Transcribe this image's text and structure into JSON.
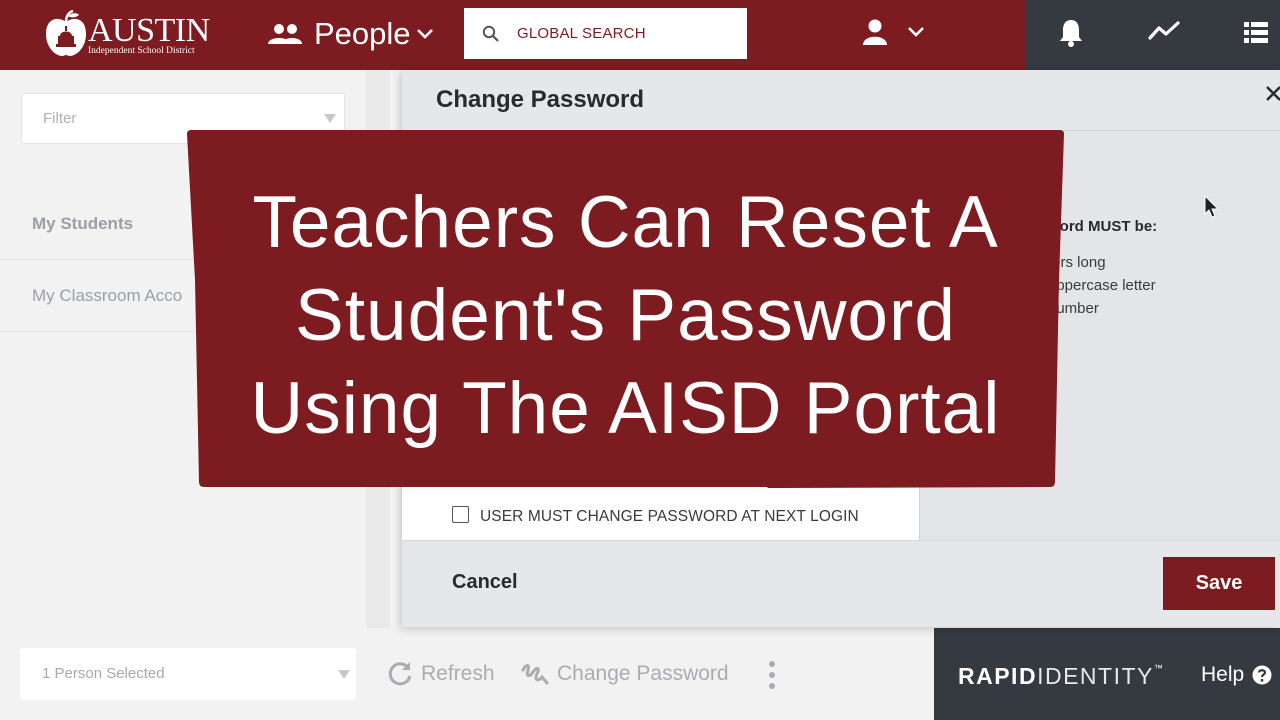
{
  "header": {
    "logo_name": "AUSTIN",
    "logo_subtitle": "Independent School District",
    "module_label": "People",
    "search_placeholder": "GLOBAL SEARCH"
  },
  "sidebar": {
    "filter_placeholder": "Filter",
    "items": [
      {
        "label": "My Students"
      },
      {
        "label": "My Classroom Acco"
      }
    ]
  },
  "bottom_bar": {
    "selection": "1 Person Selected",
    "refresh_label": "Refresh",
    "change_password_label": "Change Password"
  },
  "brand": {
    "name_bold": "RAPID",
    "name_light": "IDENTITY",
    "trademark": "™",
    "help_label": "Help"
  },
  "modal": {
    "title": "Change Password",
    "requirements_title": "word MUST be:",
    "requirements": [
      "ters long",
      "uppercase letter",
      "number"
    ],
    "must_change_label": "USER MUST CHANGE PASSWORD AT NEXT LOGIN",
    "cancel_label": "Cancel",
    "save_label": "Save"
  },
  "overlay": {
    "lines": [
      "Teachers Can Reset A",
      "Student's Password",
      "Using The AISD Portal"
    ]
  },
  "colors": {
    "brand_maroon": "#7c1c21",
    "dark_gray": "#343a3f"
  }
}
